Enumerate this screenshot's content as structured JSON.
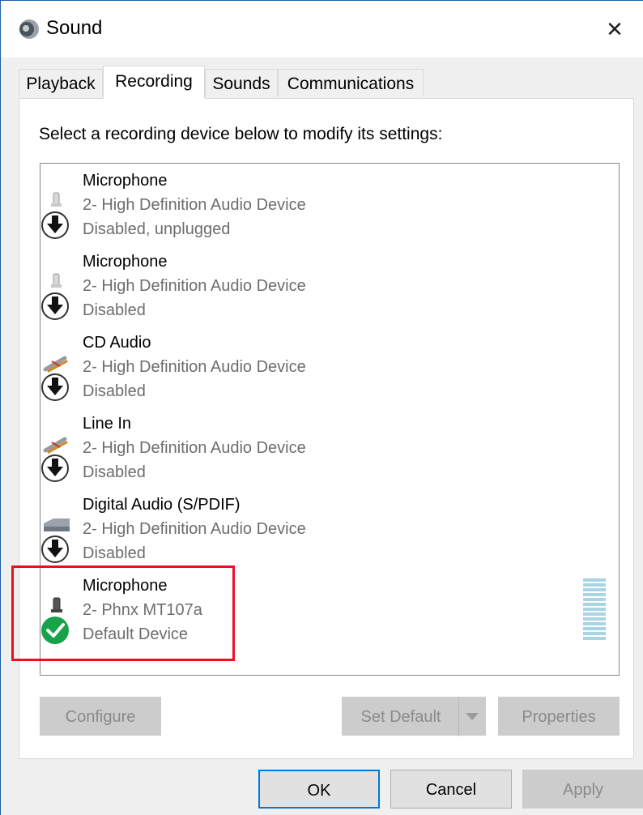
{
  "window": {
    "title": "Sound",
    "close_glyph": "✕"
  },
  "tabs": [
    {
      "label": "Playback",
      "active": false
    },
    {
      "label": "Recording",
      "active": true
    },
    {
      "label": "Sounds",
      "active": false
    },
    {
      "label": "Communications",
      "active": false
    }
  ],
  "instruction": "Select a recording device below to modify its settings:",
  "devices": [
    {
      "name": "Microphone",
      "driver": "2- High Definition Audio Device",
      "status": "Disabled, unplugged",
      "icon": "microphone-icon",
      "state_icon": "disabled-arrow-icon"
    },
    {
      "name": "Microphone",
      "driver": "2- High Definition Audio Device",
      "status": "Disabled",
      "icon": "microphone-icon",
      "state_icon": "disabled-arrow-icon"
    },
    {
      "name": "CD Audio",
      "driver": "2- High Definition Audio Device",
      "status": "Disabled",
      "icon": "cable-plug-icon",
      "state_icon": "disabled-arrow-icon"
    },
    {
      "name": "Line In",
      "driver": "2- High Definition Audio Device",
      "status": "Disabled",
      "icon": "cable-plug-icon",
      "state_icon": "disabled-arrow-icon"
    },
    {
      "name": "Digital Audio (S/PDIF)",
      "driver": "2- High Definition Audio Device",
      "status": "Disabled",
      "icon": "digital-port-icon",
      "state_icon": "disabled-arrow-icon"
    },
    {
      "name": "Microphone",
      "driver": "2- Phnx MT107a",
      "status": "Default Device",
      "icon": "microphone-icon",
      "state_icon": "default-check-icon"
    }
  ],
  "buttons": {
    "configure": "Configure",
    "set_default": "Set Default",
    "properties": "Properties",
    "ok": "OK",
    "cancel": "Cancel",
    "apply": "Apply"
  },
  "colors": {
    "highlight": "#e81123",
    "check_green": "#16a34a",
    "meter": "#a8d4e6",
    "focus_border": "#0078d7"
  }
}
